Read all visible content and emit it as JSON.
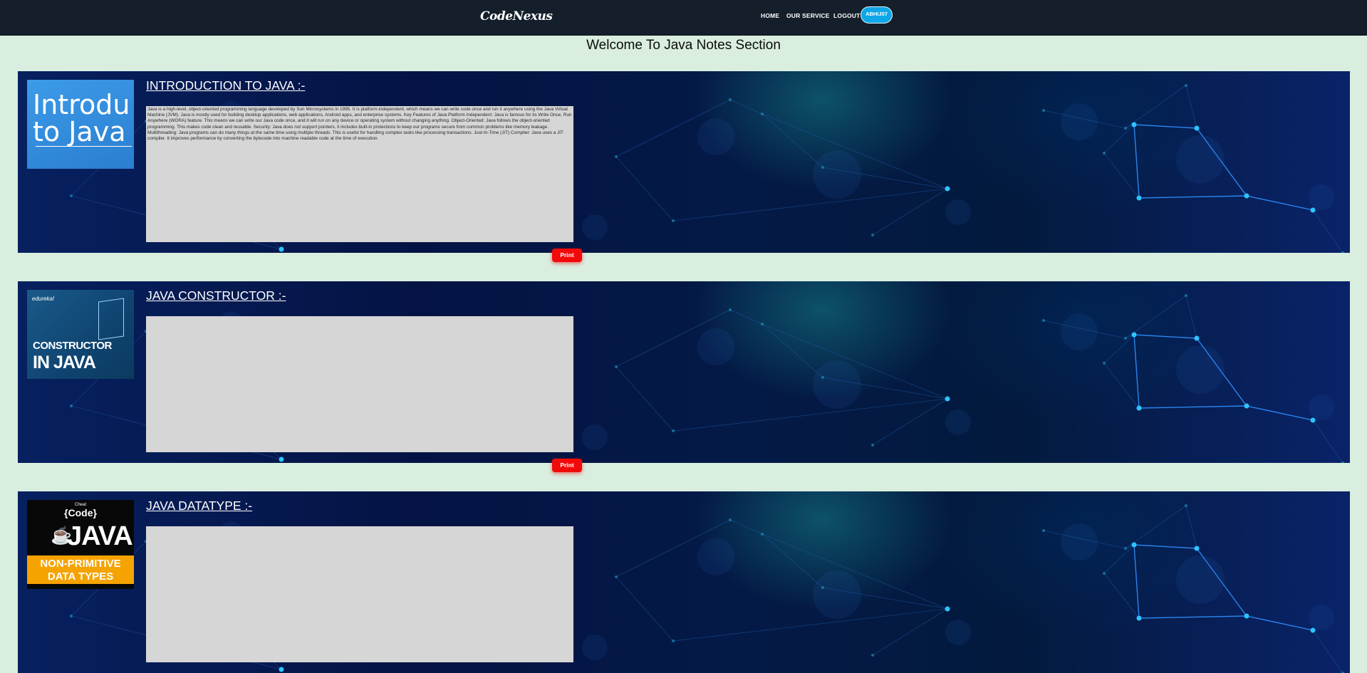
{
  "nav": {
    "brand": "CodeNexus",
    "links": [
      "HOME",
      "OUR SERVICE",
      "LOGOUT"
    ],
    "user": "ABHIJ07"
  },
  "page_title": "Welcome To Java Notes Section",
  "notes": [
    {
      "title": "INTRODUCTION TO JAVA :-",
      "thumbnail": {
        "line1": "Introdu",
        "line2": "to Java"
      },
      "body": "Java is a high-level, object-oriented programming language developed by Sun Microsystems in 1995. It is platform-independent, which means we can write code once and run it anywhere using the Java Virtual Machine (JVM). Java is mostly used for building desktop applications, web applications, Android apps, and enterprise systems. Key Features of Java Platform Independent: Java is famous for its Write Once, Run Anywhere (WORA) feature. This means we can write our Java code once, and it will run on any device or operating system without changing anything. Object-Oriented: Java follows the object-oriented programming. This makes code clean and reusable. Security: Java does not support pointers, it includes built-in protections to keep our programs secure from common problems like memory leakage. Multithreading: Java programs can do many things at the same time using multiple threads. This is useful for handling complex tasks like processing transactions. Just-In-Time (JIT) Compiler: Java uses a JIT compiler. It improves performance by converting the bytecode into machine readable code at the time of execution.",
      "print_label": "Print"
    },
    {
      "title": "JAVA CONSTRUCTOR :-",
      "thumbnail": {
        "brand": "edureka!",
        "line1": "CONSTRUCTOR",
        "line2": "IN JAVA"
      },
      "body": "",
      "print_label": "Print"
    },
    {
      "title": "JAVA DATATYPE :-",
      "thumbnail": {
        "small": "Cheat",
        "code": "{Code}",
        "big": "JAVA",
        "band1": "NON-PRIMITIVE",
        "band2": "DATA TYPES"
      },
      "body": ""
    }
  ]
}
